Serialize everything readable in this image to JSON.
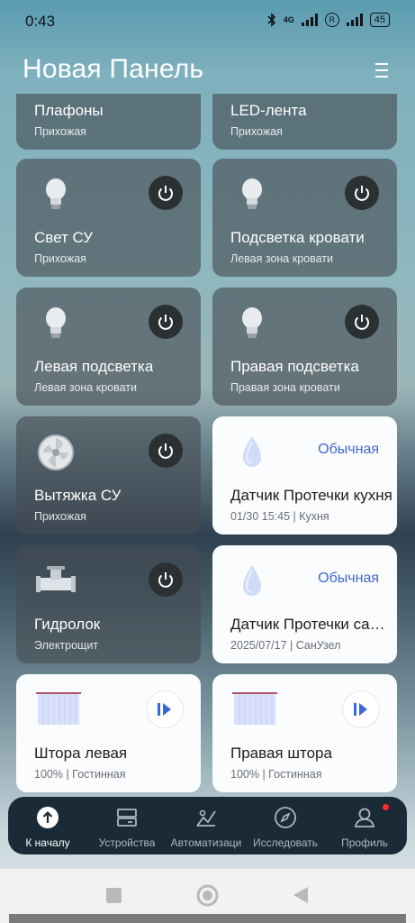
{
  "status_bar": {
    "time": "0:43",
    "network_label": "4G",
    "roaming_label": "R",
    "battery": "45"
  },
  "header": {
    "title": "Новая Панель"
  },
  "cards": [
    {
      "name": "Плафоны",
      "room": "Прихожая"
    },
    {
      "name": "LED-лента",
      "room": "Прихожая"
    },
    {
      "name": "Свет СУ",
      "room": "Прихожая",
      "icon": "bulb-icon"
    },
    {
      "name": "Подсветка кровати",
      "room": "Левая зона кровати",
      "icon": "bulb-icon"
    },
    {
      "name": "Левая подсветка",
      "room": "Левая зона кровати",
      "icon": "bulb-icon"
    },
    {
      "name": "Правая подсветка",
      "room": "Правая зона кровати",
      "icon": "bulb-icon"
    },
    {
      "name": "Вытяжка СУ",
      "room": "Прихожая",
      "icon": "fan-icon"
    },
    {
      "name": "Датчик Протечки кухня",
      "room": "01/30 15:45 | Кухня",
      "status": "Обычная",
      "icon": "water-drop-icon"
    },
    {
      "name": "Гидролок",
      "room": "Электрощит",
      "icon": "valve-icon"
    },
    {
      "name": "Датчик Протечки санузел",
      "room": "2025/07/17 | СанУзел",
      "status": "Обычная",
      "icon": "water-drop-icon"
    },
    {
      "name": "Штора левая",
      "room": "100% | Гостинная",
      "icon": "curtain-icon"
    },
    {
      "name": "Правая штора",
      "room": "100% | Гостинная",
      "icon": "curtain-icon"
    }
  ],
  "tabs": [
    {
      "label": "К началу",
      "icon": "home-arrow-icon",
      "active": true
    },
    {
      "label": "Устройства",
      "icon": "devices-icon"
    },
    {
      "label": "Автоматизаци",
      "icon": "automation-icon"
    },
    {
      "label": "Исследовать",
      "icon": "compass-icon"
    },
    {
      "label": "Профиль",
      "icon": "profile-icon"
    }
  ],
  "colors": {
    "accent_blue": "#3b68d8",
    "notification_dot": "#ff2d2d",
    "tabbar_bg": "#1a2a36"
  }
}
